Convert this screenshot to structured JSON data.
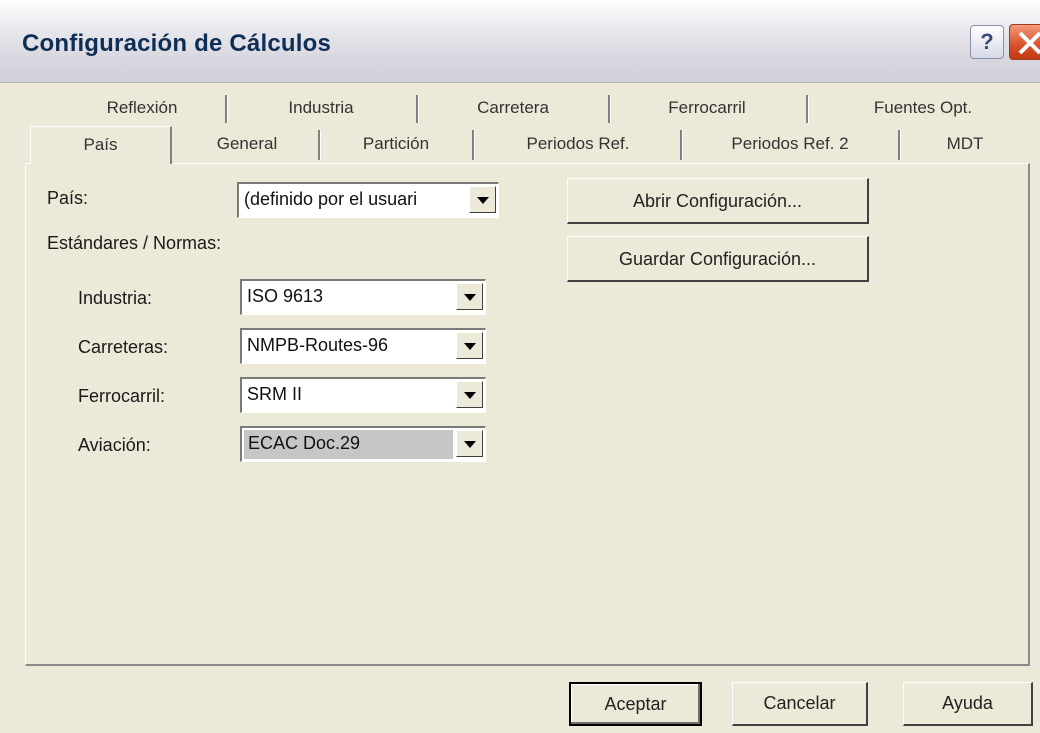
{
  "window": {
    "title": "Configuración de Cálculos"
  },
  "titlebar": {
    "help_label": "?"
  },
  "tabs_row1": [
    "Reflexión",
    "Industria",
    "Carretera",
    "Ferrocarril",
    "Fuentes Opt."
  ],
  "tabs_row2": [
    "País",
    "General",
    "Partición",
    "Periodos Ref.",
    "Periodos Ref. 2",
    "MDT"
  ],
  "active_tab": "País",
  "form": {
    "country_label": "País:",
    "country_value": "(definido por el usuari",
    "standards_label": "Estándares / Normas:",
    "industry_label": "Industria:",
    "industry_value": "ISO 9613",
    "roads_label": "Carreteras:",
    "roads_value": "NMPB-Routes-96",
    "rail_label": "Ferrocarril:",
    "rail_value": "SRM II",
    "aviation_label": "Aviación:",
    "aviation_value": "ECAC Doc.29"
  },
  "buttons": {
    "open_config": "Abrir Configuración...",
    "save_config": "Guardar Configuración...",
    "accept": "Aceptar",
    "cancel": "Cancelar",
    "help": "Ayuda"
  }
}
